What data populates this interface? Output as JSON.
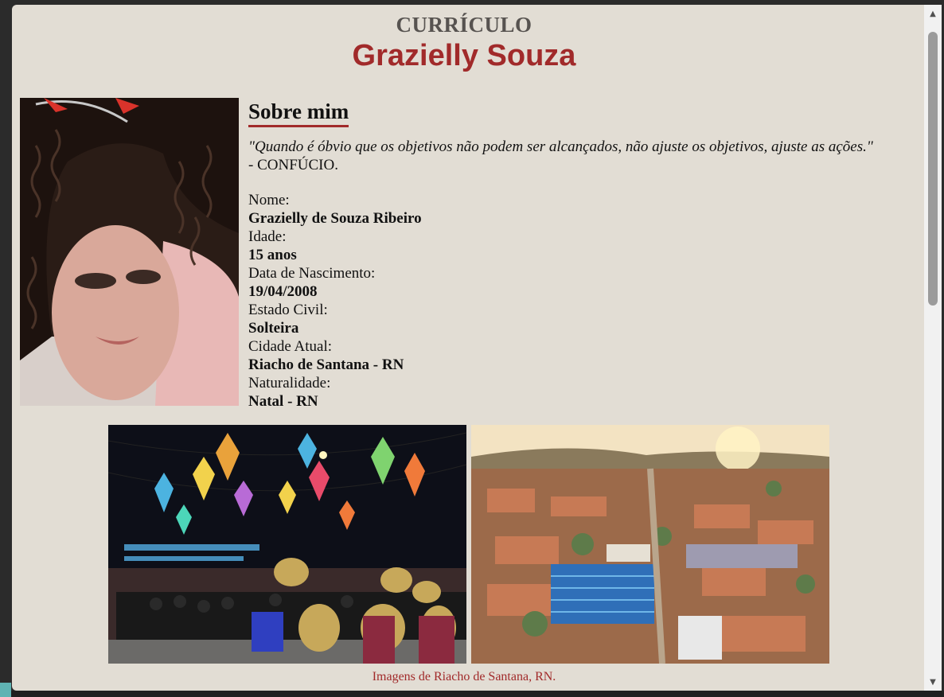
{
  "header": {
    "label": "CURRÍCULO",
    "name": "Grazielly Souza"
  },
  "about": {
    "title": "Sobre mim",
    "quote": "\"Quando é óbvio que os objetivos não podem ser alcançados, não ajuste os objetivos, ajuste as ações.\"",
    "quote_author": "- CONFÚCIO.",
    "facts": [
      {
        "label": "Nome:",
        "value": "Grazielly de Souza Ribeiro"
      },
      {
        "label": "Idade:",
        "value": "15 anos"
      },
      {
        "label": "Data de Nascimento:",
        "value": "19/04/2008"
      },
      {
        "label": "Estado Civil:",
        "value": "Solteira"
      },
      {
        "label": "Cidade Atual:",
        "value": "Riacho de Santana - RN"
      },
      {
        "label": "Naturalidade:",
        "value": "Natal - RN"
      }
    ]
  },
  "gallery": {
    "caption": "Imagens de Riacho de Santana, RN."
  },
  "colors": {
    "page_bg": "#e2ddd4",
    "accent": "#a12a2a",
    "label_gray": "#575350"
  },
  "icons": {
    "scroll_up": "▲",
    "scroll_down": "▼"
  }
}
